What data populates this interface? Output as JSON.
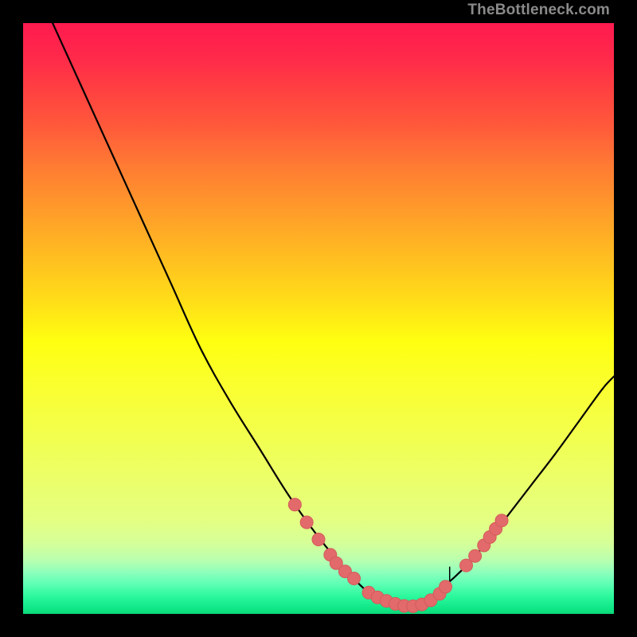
{
  "watermark": "TheBottleneck.com",
  "colors": {
    "curve": "#000000",
    "dot_fill": "#e36a6a",
    "dot_stroke": "#d45b5b"
  },
  "chart_data": {
    "type": "line",
    "title": "",
    "xlabel": "",
    "ylabel": "",
    "xlim": [
      0,
      100
    ],
    "ylim": [
      0,
      100
    ],
    "series": [
      {
        "name": "bottleneck-curve-left",
        "x": [
          5,
          10,
          15,
          20,
          25,
          30,
          35,
          40,
          45,
          50,
          55,
          58,
          60,
          62,
          64
        ],
        "y": [
          100,
          89,
          78,
          67,
          56,
          45,
          36,
          28,
          20,
          13,
          7,
          4,
          2.5,
          1.6,
          1.2
        ]
      },
      {
        "name": "bottleneck-curve-right",
        "x": [
          64,
          66,
          68,
          70,
          73,
          76,
          79,
          82,
          86,
          90,
          94,
          98,
          100
        ],
        "y": [
          1.2,
          1.5,
          2.2,
          3.6,
          6.2,
          9.2,
          12.8,
          16.6,
          21.8,
          27.0,
          32.5,
          38.0,
          40.2
        ]
      }
    ],
    "dots_left": {
      "name": "marker-cluster-left",
      "x": [
        46,
        48,
        50,
        52,
        53,
        54.5,
        56
      ],
      "y": [
        18.5,
        15.5,
        12.6,
        10.0,
        8.6,
        7.2,
        6.0
      ]
    },
    "dots_bottom": {
      "name": "marker-cluster-bottom",
      "x": [
        58.5,
        60,
        61.5,
        63,
        64.5,
        66,
        67.5,
        69,
        70.5,
        71.5
      ],
      "y": [
        3.6,
        2.8,
        2.2,
        1.7,
        1.35,
        1.3,
        1.6,
        2.3,
        3.4,
        4.6
      ]
    },
    "dots_right": {
      "name": "marker-cluster-right",
      "x": [
        75,
        76.5,
        78,
        79,
        80,
        81
      ],
      "y": [
        8.2,
        9.8,
        11.6,
        13.0,
        14.4,
        15.8
      ]
    },
    "spike": {
      "name": "spike-tick",
      "x": 72.2,
      "y_base": 5.0,
      "y_tip": 8.0
    }
  }
}
